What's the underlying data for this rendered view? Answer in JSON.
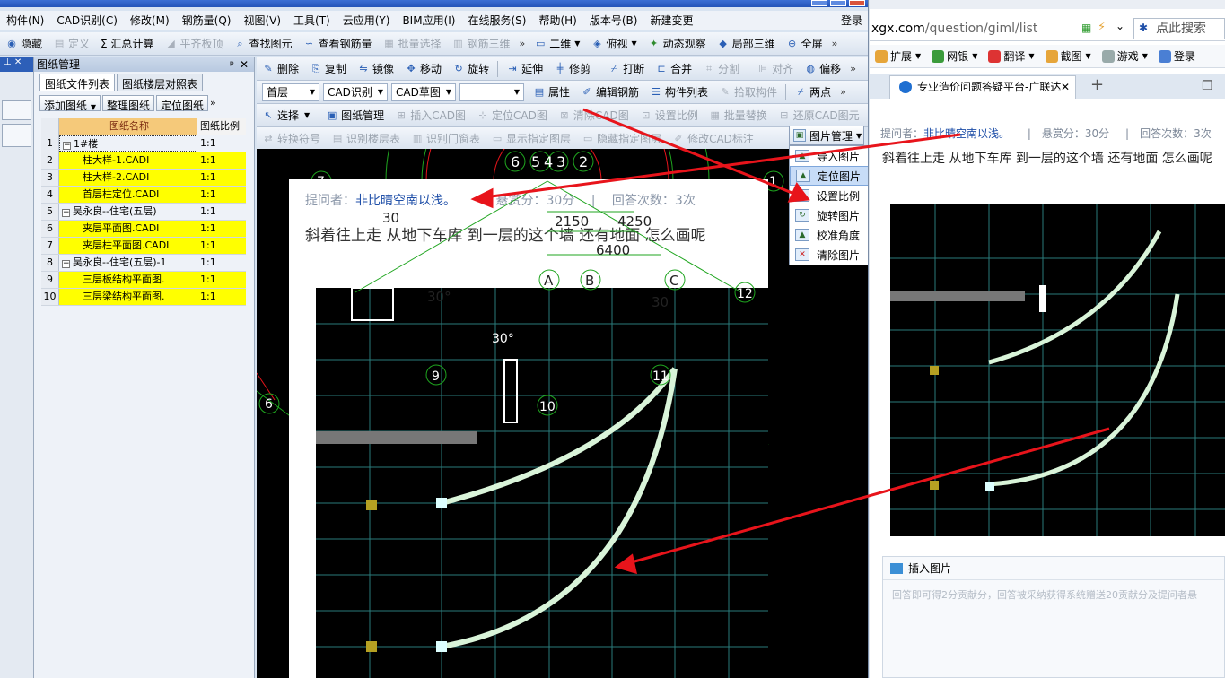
{
  "cad_app": {
    "menu": [
      "构件(N)",
      "CAD识别(C)",
      "修改(M)",
      "钢筋量(Q)",
      "视图(V)",
      "工具(T)",
      "云应用(Y)",
      "BIM应用(I)",
      "在线服务(S)",
      "帮助(H)",
      "版本号(B)",
      "新建变更",
      "登录"
    ],
    "toolbar1": [
      "隐藏",
      "定义",
      "Σ 汇总计算",
      "平齐板顶",
      "查找图元",
      "查看钢筋量",
      "批量选择",
      "钢筋三维",
      "二维",
      "俯视",
      "动态观察",
      "局部三维",
      "全屏"
    ],
    "toolbar2": [
      "删除",
      "复制",
      "镜像",
      "移动",
      "旋转",
      "延伸",
      "修剪",
      "打断",
      "合并",
      "分割",
      "对齐",
      "偏移"
    ],
    "toolbar3": {
      "floor": "首层",
      "cad_recog": "CAD识别",
      "cad_draft": "CAD草图",
      "items": [
        "属性",
        "编辑钢筋",
        "构件列表",
        "拾取构件",
        "两点"
      ]
    },
    "toolbar4": [
      "选择",
      "图纸管理",
      "插入CAD图",
      "定位CAD图",
      "清除CAD图",
      "设置比例",
      "批量替换",
      "还原CAD图元"
    ],
    "toolbar5": [
      "转换符号",
      "识别楼层表",
      "识别门窗表",
      "显示指定图层",
      "隐藏指定图层",
      "修改CAD标注"
    ],
    "panel": {
      "title": "图纸管理",
      "tabs": [
        "图纸文件列表",
        "图纸楼层对照表"
      ],
      "buttons": [
        "添加图纸",
        "整理图纸",
        "定位图纸"
      ],
      "col_name": "图纸名称",
      "col_scale": "图纸比例",
      "rows": [
        {
          "num": "1",
          "name": "1#楼",
          "scale": "1:1",
          "type": "group"
        },
        {
          "num": "2",
          "name": "柱大样-1.CADI",
          "scale": "1:1",
          "type": "file"
        },
        {
          "num": "3",
          "name": "柱大样-2.CADI",
          "scale": "1:1",
          "type": "file"
        },
        {
          "num": "4",
          "name": "首层柱定位.CADI",
          "scale": "1:1",
          "type": "file"
        },
        {
          "num": "5",
          "name": "吴永良--住宅(五层)",
          "scale": "1:1",
          "type": "group"
        },
        {
          "num": "6",
          "name": "夹层平面图.CADI",
          "scale": "1:1",
          "type": "file"
        },
        {
          "num": "7",
          "name": "夹层柱平面图.CADI",
          "scale": "1:1",
          "type": "file"
        },
        {
          "num": "8",
          "name": "吴永良--住宅(五层)-1",
          "scale": "1:1",
          "type": "group"
        },
        {
          "num": "9",
          "name": "三层板结构平面图.",
          "scale": "1:1",
          "type": "file"
        },
        {
          "num": "10",
          "name": "三层梁结构平面图.",
          "scale": "1:1",
          "type": "file"
        }
      ]
    },
    "context_button": "图片管理",
    "context_menu": [
      "导入图片",
      "定位图片",
      "设置比例",
      "旋转图片",
      "校准角度",
      "清除图片"
    ],
    "photo": {
      "asker_label": "提问者：",
      "asker_name": "非比晴空南以浅。",
      "reward": "悬赏分：30分",
      "answers": "回答次数：3次",
      "question": "斜着往上走 从地下车库 到一层的这个墙 还有地面 怎么画呢"
    },
    "cad_labels": {
      "axis_nums": [
        "6",
        "5",
        "4",
        "3",
        "2",
        "7",
        "1",
        "6",
        "9",
        "10",
        "11",
        "12"
      ],
      "axis_letters": [
        "A",
        "B",
        "C"
      ],
      "dims": [
        "2150",
        "4250",
        "6400"
      ],
      "angles": [
        "30°",
        "30°",
        "30",
        "30"
      ]
    }
  },
  "browser": {
    "url_domain": "xgx.com",
    "url_path": "/question/giml/list",
    "search_placeholder": "点此搜索",
    "favorites": [
      "扩展",
      "网银",
      "翻译",
      "截图",
      "游戏",
      "登录"
    ],
    "tab_title": "专业造价问题答疑平台-广联达",
    "asker_label": "提问者：",
    "asker_name": "非比晴空南以浅。",
    "reward": "悬赏分：30分",
    "answers": "回答次数：3次",
    "question": "斜着往上走 从地下车库 到一层的这个墙 还有地面 怎么画呢",
    "insert_image": "插入图片",
    "answer_hint": "回答即可得2分贡献分，回答被采纳获得系统赠送20贡献分及提问者悬"
  },
  "colors": {
    "accent": "#2a5fb5",
    "highlight_yellow": "#ffff00",
    "arrow_red": "#e8141b",
    "cad_green": "#1fa51f"
  }
}
